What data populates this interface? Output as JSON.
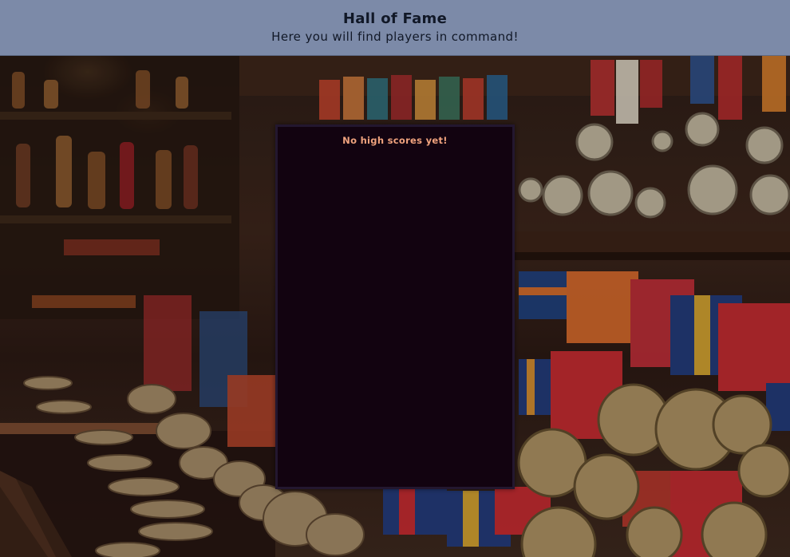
{
  "header": {
    "title": "Hall of Fame",
    "subtitle": "Here you will find players in command!"
  },
  "high_scores": {
    "empty_message": "No high scores yet!",
    "entries": []
  },
  "colors": {
    "header_bg": "#7c8aa8",
    "header_text": "#111827",
    "panel_bg": "#120310",
    "panel_border": "#23172f",
    "empty_message_text": "#f0a37e"
  },
  "background": {
    "icon": "medals-display-photo"
  }
}
